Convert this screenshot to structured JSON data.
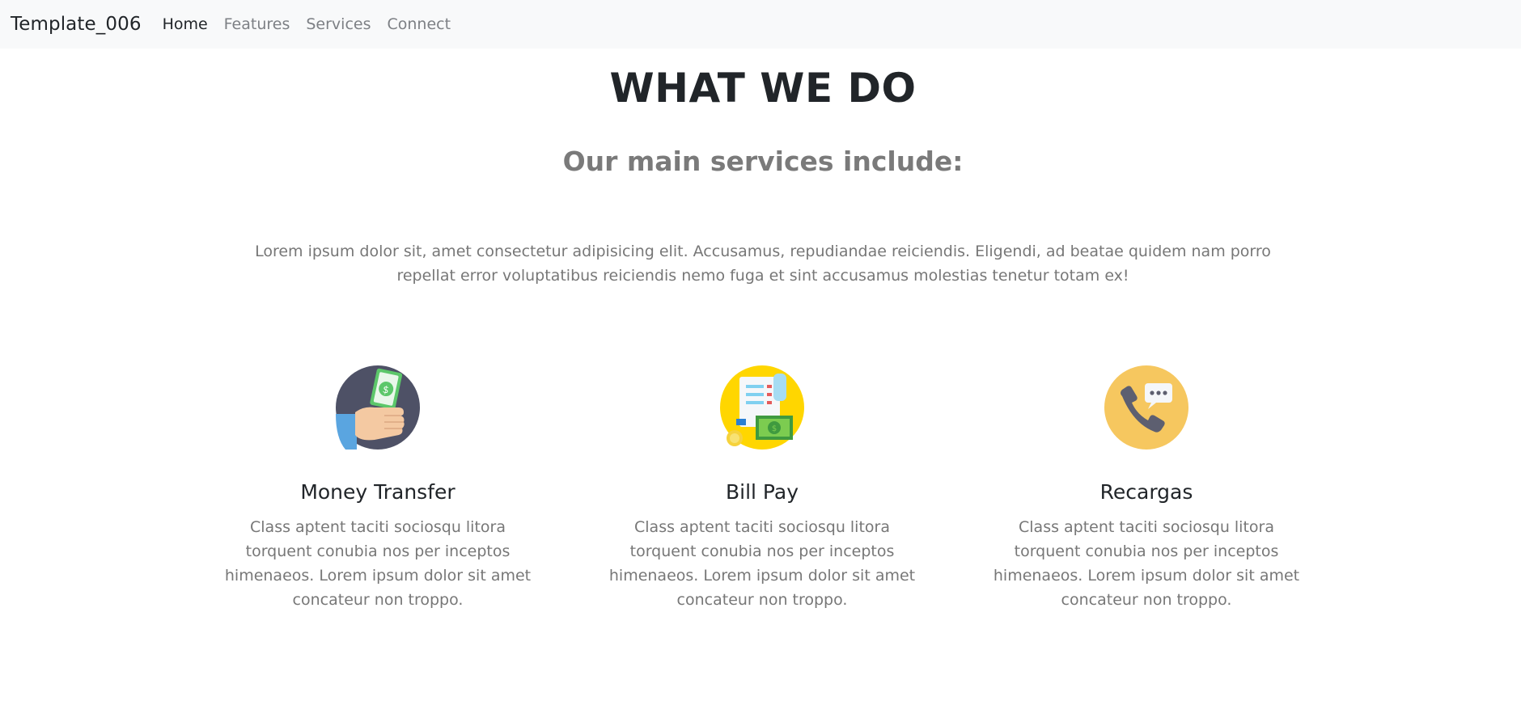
{
  "navbar": {
    "brand": "Template_006",
    "links": [
      {
        "label": "Home",
        "active": true
      },
      {
        "label": "Features",
        "active": false
      },
      {
        "label": "Services",
        "active": false
      },
      {
        "label": "Connect",
        "active": false
      }
    ]
  },
  "hero": {
    "title": "WHAT WE DO",
    "subtitle": "Our main services include:",
    "lead": "Lorem ipsum dolor sit, amet consectetur adipisicing elit. Accusamus, repudiandae reiciendis. Eligendi, ad beatae quidem nam porro repellat error voluptatibus reiciendis nemo fuga et sint accusamus molestias tenetur totam ex!"
  },
  "services": [
    {
      "icon": "money-transfer-icon",
      "title": "Money Transfer",
      "text": "Class aptent taciti sociosqu litora torquent conubia nos per inceptos himenaeos. Lorem ipsum dolor sit amet concateur non troppo."
    },
    {
      "icon": "bill-pay-icon",
      "title": "Bill Pay",
      "text": "Class aptent taciti sociosqu litora torquent conubia nos per inceptos himenaeos. Lorem ipsum dolor sit amet concateur non troppo."
    },
    {
      "icon": "phone-chat-icon",
      "title": "Recargas",
      "text": "Class aptent taciti sociosqu litora torquent conubia nos per inceptos himenaeos. Lorem ipsum dolor sit amet concateur non troppo."
    }
  ],
  "colors": {
    "navbar_bg": "#f8f9fa",
    "text_dark": "#212529",
    "text_muted": "#777777",
    "icon_dark_bg": "#4e5166",
    "icon_yellow_bg": "#ffd600",
    "icon_orange_bg": "#f6c75f"
  }
}
